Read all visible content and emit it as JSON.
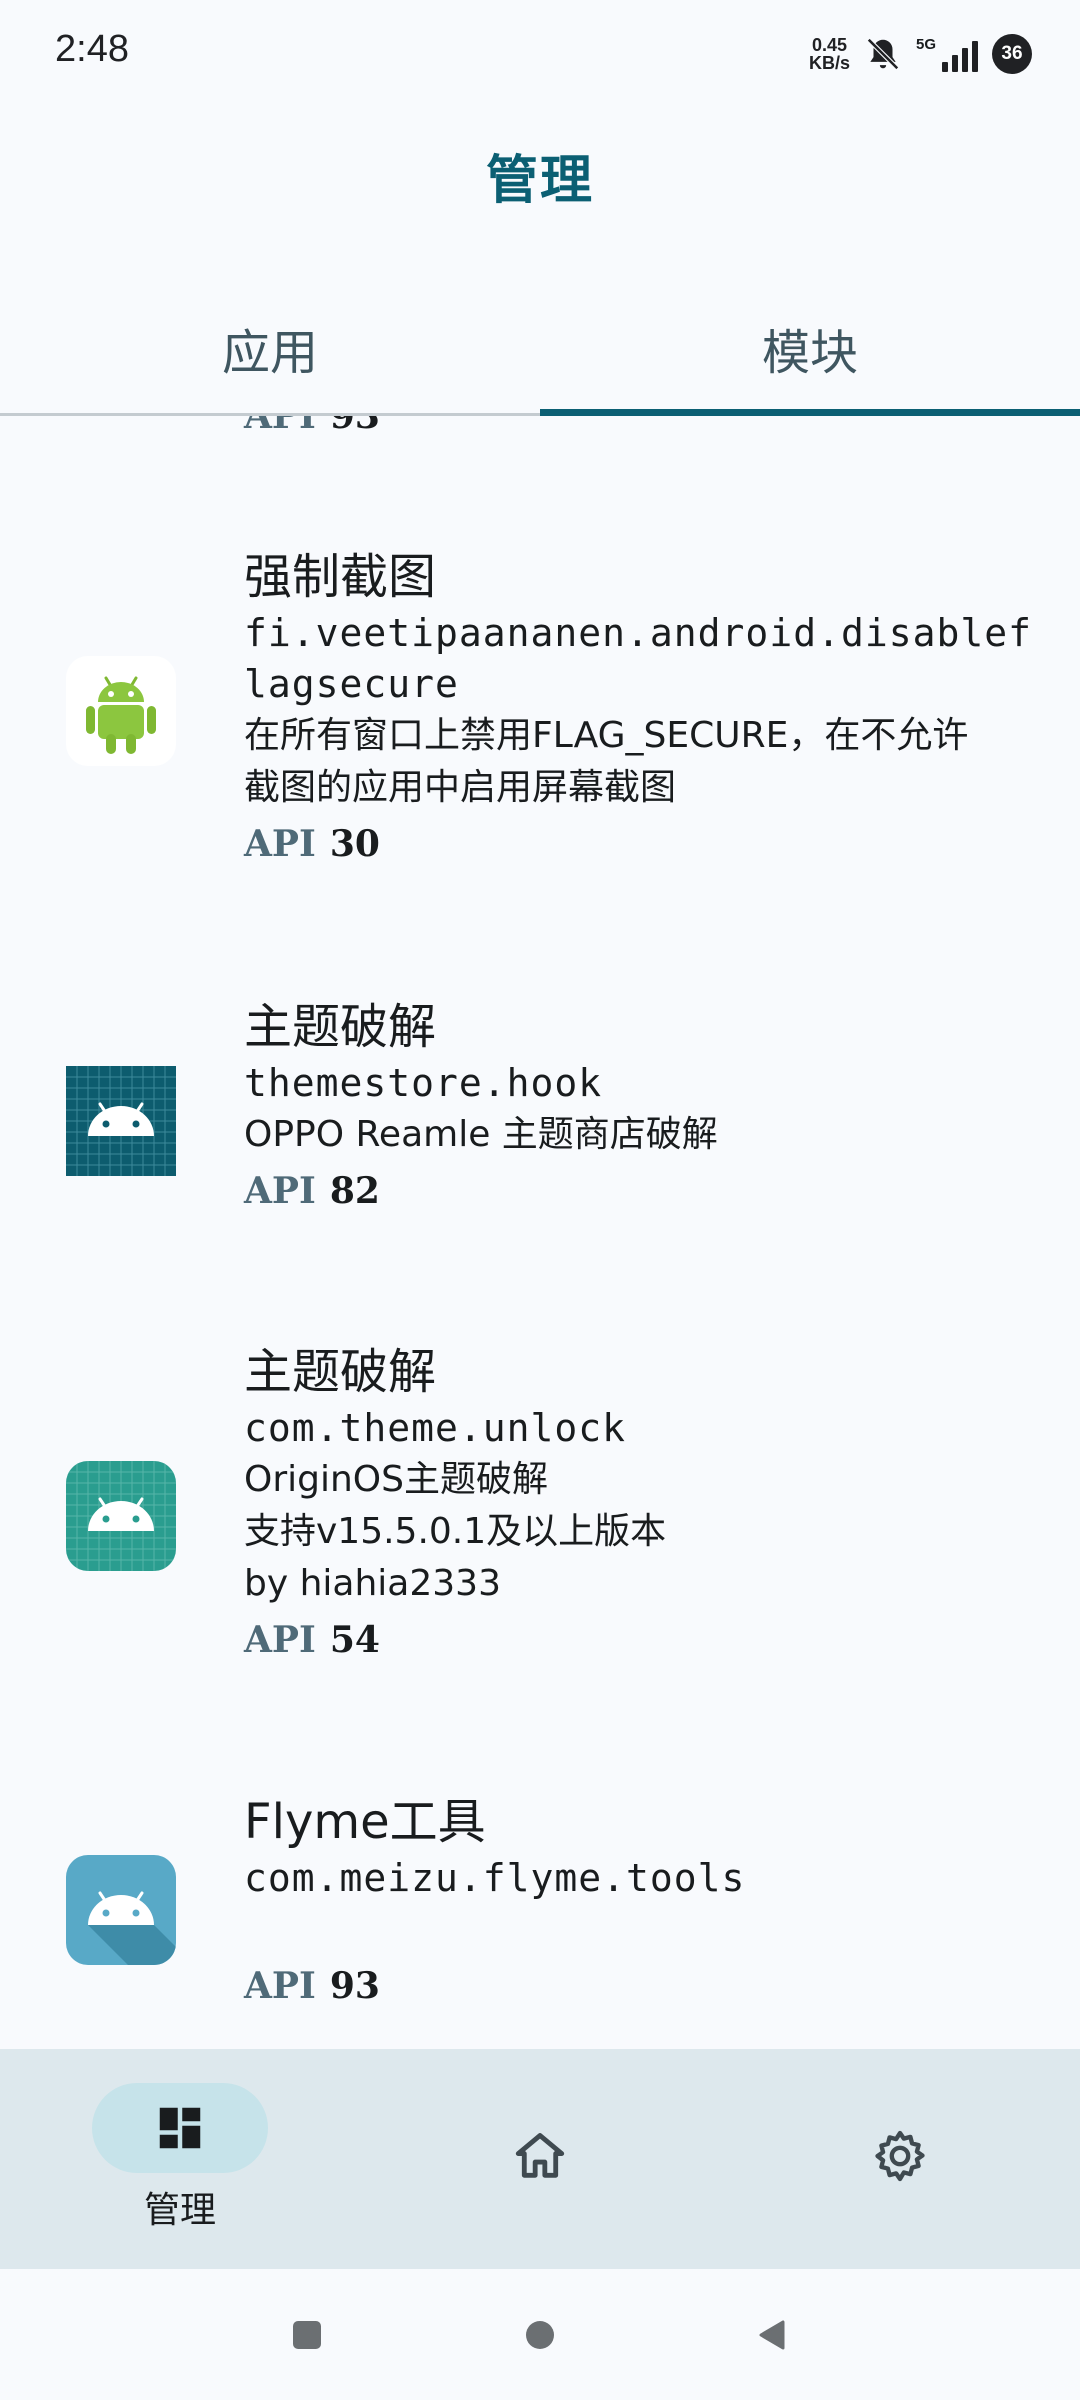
{
  "status_bar": {
    "time": "2:48",
    "speed_value": "0.45",
    "speed_unit": "KB/s",
    "network": "5G",
    "battery": "36"
  },
  "title": "管理",
  "tabs": [
    {
      "label": "应用",
      "selected": false
    },
    {
      "label": "模块",
      "selected": true
    }
  ],
  "partial_item": {
    "api_label": "API",
    "api_value": "93"
  },
  "modules": [
    {
      "name": "强制截图",
      "package": "fi.veetipaananen.android.disableflagsecure",
      "description": "在所有窗口上禁用FLAG_SECURE，在不允许截图的应用中启用屏幕截图",
      "api_label": "API",
      "api_value": "30",
      "icon": "android-robot-icon"
    },
    {
      "name": "主题破解",
      "package": "themestore.hook",
      "description": "OPPO Reamle 主题商店破解",
      "api_label": "API",
      "api_value": "82",
      "icon": "android-default-icon"
    },
    {
      "name": "主题破解",
      "package": "com.theme.unlock",
      "description": "OriginOS主题破解\n支持v15.5.0.1及以上版本\nby hiahia2333",
      "api_label": "API",
      "api_value": "54",
      "icon": "android-default-icon"
    },
    {
      "name": "Flyme工具",
      "package": "com.meizu.flyme.tools",
      "description": "",
      "api_label": "API",
      "api_value": "93",
      "icon": "android-default-icon"
    }
  ],
  "bottom_nav": {
    "manage_label": "管理",
    "active": "manage"
  },
  "colors": {
    "accent": "#0b5f73",
    "background": "#f8fafd",
    "nav_background": "#dde8ed",
    "active_pill": "#c6e3ea"
  }
}
